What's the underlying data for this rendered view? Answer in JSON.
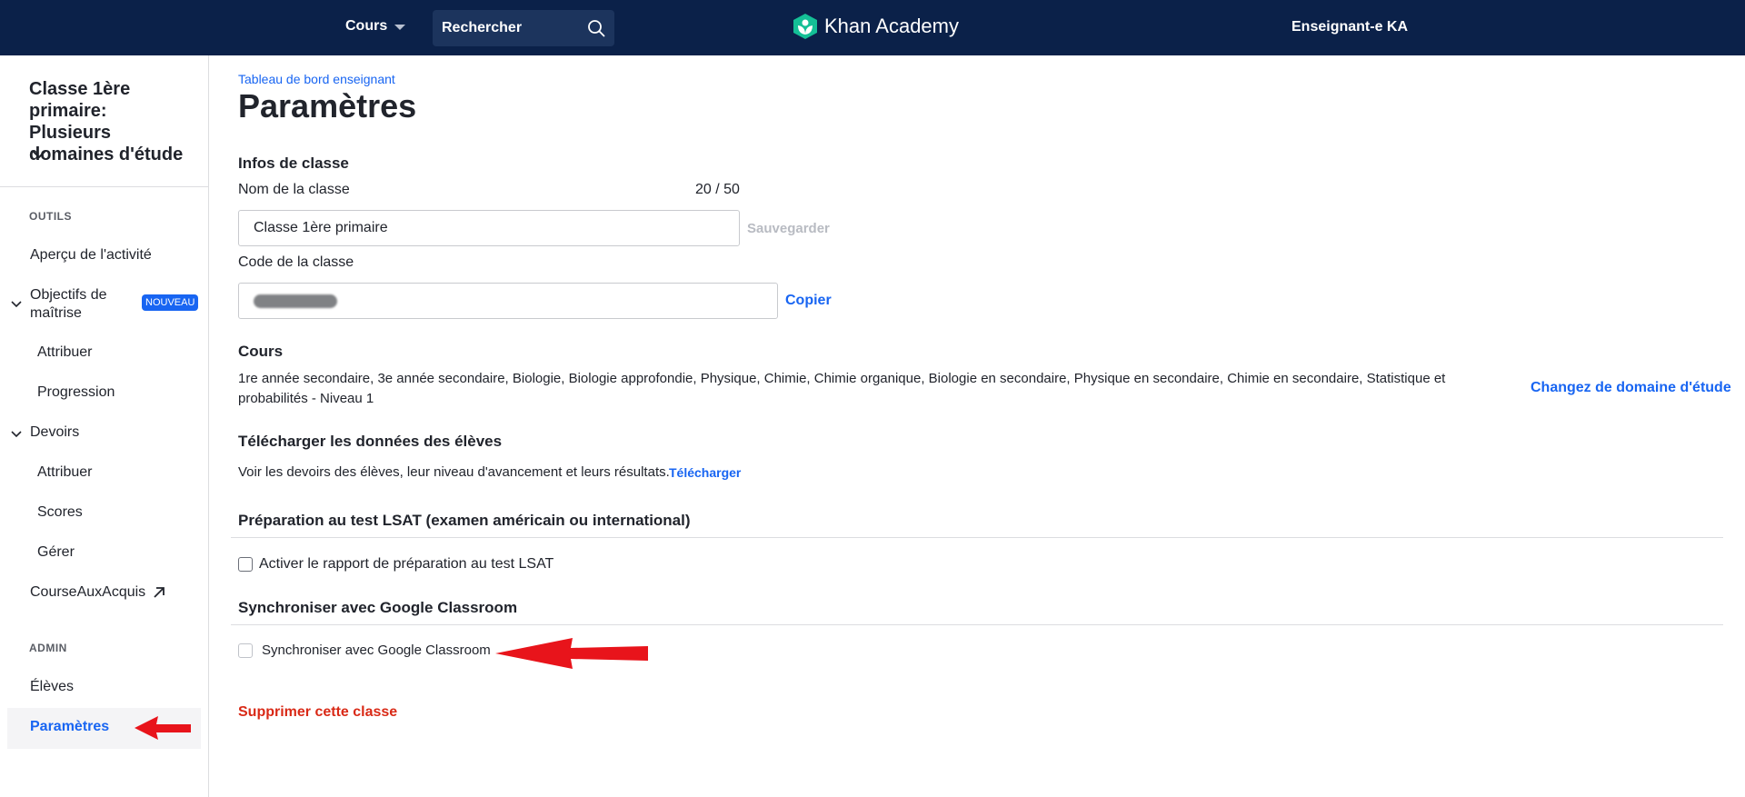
{
  "topnav": {
    "courses_label": "Cours",
    "search_placeholder": "Rechercher",
    "logo_text": "Khan Academy",
    "user_label": "Enseignant-e KA",
    "bg_color": "#0b2149"
  },
  "sidebar": {
    "class_title": "Classe 1ère primaire: Plusieurs domaines d'étude",
    "tools_label": "OUTILS",
    "activity_overview": "Aperçu de l'activité",
    "mastery_goals": "Objectifs de maîtrise",
    "new_badge": "NOUVEAU",
    "mastery_assign": "Attribuer",
    "mastery_progress": "Progression",
    "assignments": "Devoirs",
    "assign": "Attribuer",
    "scores": "Scores",
    "manage": "Gérer",
    "course_challenge": "CourseAuxAcquis",
    "admin_label": "ADMIN",
    "students": "Élèves",
    "settings": "Paramètres"
  },
  "main": {
    "breadcrumb": "Tableau de bord enseignant",
    "title": "Paramètres",
    "class_info_heading": "Infos de classe",
    "class_name_label": "Nom de la classe",
    "class_name_counter": "20 / 50",
    "class_name_value": "Classe 1ère primaire",
    "save_label": "Sauvegarder",
    "class_code_label": "Code de la classe",
    "copy_label": "Copier",
    "courses_heading": "Cours",
    "courses_list": "1re année secondaire, 3e année secondaire, Biologie, Biologie approfondie, Physique, Chimie, Chimie organique, Biologie en secondaire, Physique en secondaire, Chimie en secondaire, Statistique et probabilités - Niveau 1",
    "change_domain_label": "Changez de domaine d'étude",
    "download_heading": "Télécharger les données des élèves",
    "download_desc": "Voir les devoirs des élèves, leur niveau d'avancement et leurs résultats.",
    "download_label": "Télécharger",
    "lsat_heading": "Préparation au test LSAT (examen américain ou international)",
    "lsat_checkbox_label": "Activer le rapport de préparation au test LSAT",
    "google_heading": "Synchroniser avec Google Classroom",
    "google_checkbox_label": "Synchroniser avec Google Classroom",
    "delete_label": "Supprimer cette classe"
  },
  "colors": {
    "accent": "#1865f2",
    "danger": "#d92916",
    "annotation_arrow": "#e8141b"
  }
}
